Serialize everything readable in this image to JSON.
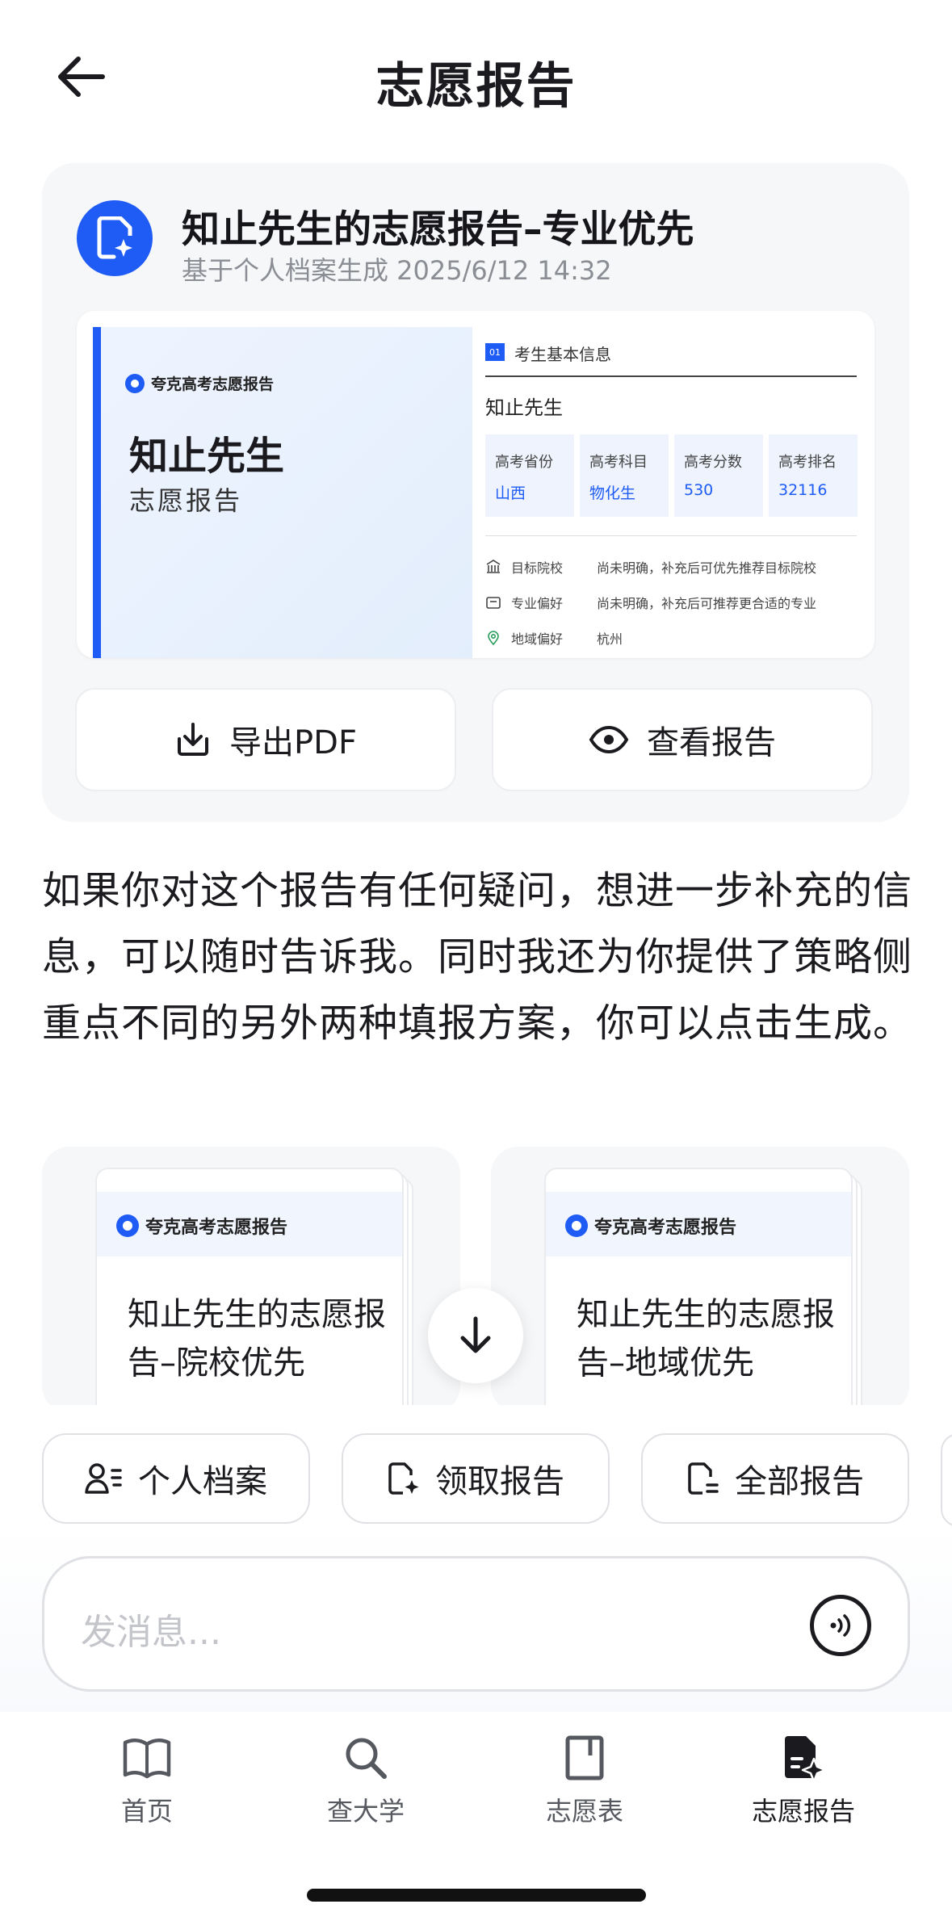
{
  "header": {
    "title": "志愿报告"
  },
  "report": {
    "title": "知止先生的志愿报告–专业优先",
    "subtitle": "基于个人档案生成 2025/6/12 14:32",
    "preview": {
      "brand": "夸克高考志愿报告",
      "name": "知止先生",
      "sub": "志愿报告",
      "section_no": "01",
      "section_title": "考生基本信息",
      "name2": "知止先生",
      "info": [
        {
          "label": "高考省份",
          "value": "山西"
        },
        {
          "label": "高考科目",
          "value": "物化生"
        },
        {
          "label": "高考分数",
          "value": "530"
        },
        {
          "label": "高考排名",
          "value": "32116"
        }
      ],
      "prefs": [
        {
          "label": "目标院校",
          "value": "尚未明确，补充后可优先推荐目标院校",
          "icon": "bank-icon"
        },
        {
          "label": "专业偏好",
          "value": "尚未明确，补充后可推荐更合适的专业",
          "icon": "folder-icon"
        },
        {
          "label": "地域偏好",
          "value": "杭州",
          "icon": "location-icon"
        }
      ]
    },
    "export_label": "导出PDF",
    "view_label": "查看报告"
  },
  "message": "如果你对这个报告有任何疑问，想进一步补充的信息，可以随时告诉我。同时我还为你提供了策略侧重点不同的另外两种填报方案，你可以点击生成。",
  "alt_plans": [
    {
      "brand": "夸克高考志愿报告",
      "title": "知止先生的志愿报告–院校优先"
    },
    {
      "brand": "夸克高考志愿报告",
      "title": "知止先生的志愿报告–地域优先"
    }
  ],
  "chips": [
    "个人档案",
    "领取报告",
    "全部报告"
  ],
  "input": {
    "placeholder": "发消息..."
  },
  "tabs": [
    {
      "label": "首页",
      "icon": "book-icon"
    },
    {
      "label": "查大学",
      "icon": "search-icon"
    },
    {
      "label": "志愿表",
      "icon": "document-icon"
    },
    {
      "label": "志愿报告",
      "icon": "report-icon",
      "active": true
    }
  ],
  "colors": {
    "accent": "#1f5cf5",
    "card_bg": "#f6f7f9",
    "text": "#1b1b1f"
  }
}
